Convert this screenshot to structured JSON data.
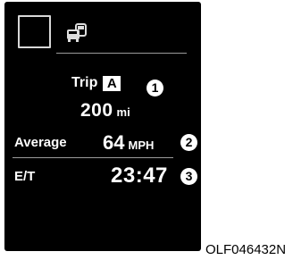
{
  "trip": {
    "label": "Trip",
    "badge": "A",
    "value": "200",
    "unit": "mi"
  },
  "average": {
    "label": "Average",
    "value": "64",
    "unit": "MPH"
  },
  "elapsed_time": {
    "label": "E/T",
    "value": "23:47"
  },
  "callouts": [
    "1",
    "2",
    "3"
  ],
  "caption": "OLF046432N",
  "icons": {
    "mode_box": "blank-square-icon",
    "car": "car-trip-icon"
  }
}
